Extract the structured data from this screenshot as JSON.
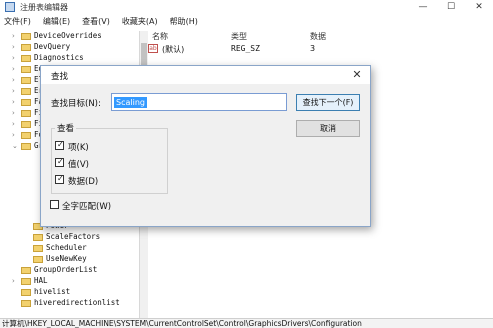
{
  "window": {
    "title": "注册表编辑器",
    "controls": {
      "minimize": "—",
      "maximize": "☐",
      "close": "✕"
    }
  },
  "menu": [
    "文件(F)",
    "编辑(E)",
    "查看(V)",
    "收藏夹(A)",
    "帮助(H)"
  ],
  "tree": {
    "items": [
      {
        "label": "DeviceOverrides",
        "expander": "›"
      },
      {
        "label": "DevQuery",
        "expander": "›"
      },
      {
        "label": "Diagnostics",
        "expander": "›"
      },
      {
        "label": "Ed",
        "expander": "›"
      },
      {
        "label": "El",
        "expander": "›"
      },
      {
        "label": "Er",
        "expander": "›"
      },
      {
        "label": "Fa",
        "expander": "›"
      },
      {
        "label": "Fi",
        "expander": "›"
      },
      {
        "label": "Fi",
        "expander": "›"
      },
      {
        "label": "Fo",
        "expander": "›"
      },
      {
        "label": "Gr",
        "expander": "⌄"
      },
      {
        "label": "Power",
        "expander": ""
      },
      {
        "label": "ScaleFactors",
        "expander": ""
      },
      {
        "label": "Scheduler",
        "expander": ""
      },
      {
        "label": "UseNewKey",
        "expander": ""
      },
      {
        "label": "GroupOrderList",
        "expander": ""
      },
      {
        "label": "HAL",
        "expander": "›"
      },
      {
        "label": "hivelist",
        "expander": ""
      },
      {
        "label": "hiveredirectionlist",
        "expander": ""
      }
    ]
  },
  "values": {
    "columns": {
      "name": "名称",
      "type": "类型",
      "data": "数据"
    },
    "rows": [
      {
        "icon": "ab",
        "name": "(默认)",
        "type": "REG_SZ",
        "data": "3"
      }
    ]
  },
  "statusbar": {
    "path": "计算机\\HKEY_LOCAL_MACHINE\\SYSTEM\\CurrentControlSet\\Control\\GraphicsDrivers\\Configuration"
  },
  "find_dialog": {
    "title": "查找",
    "close": "✕",
    "find_label": "查找目标(N):",
    "find_value": "Scaling",
    "find_next_label": "查找下一个(F)",
    "cancel_label": "取消",
    "look_at_title": "查看",
    "options": [
      {
        "label": "项(K)",
        "checked": true
      },
      {
        "label": "值(V)",
        "checked": true
      },
      {
        "label": "数据(D)",
        "checked": true
      }
    ],
    "match_whole": {
      "label": "全字匹配(W)",
      "checked": false
    }
  }
}
